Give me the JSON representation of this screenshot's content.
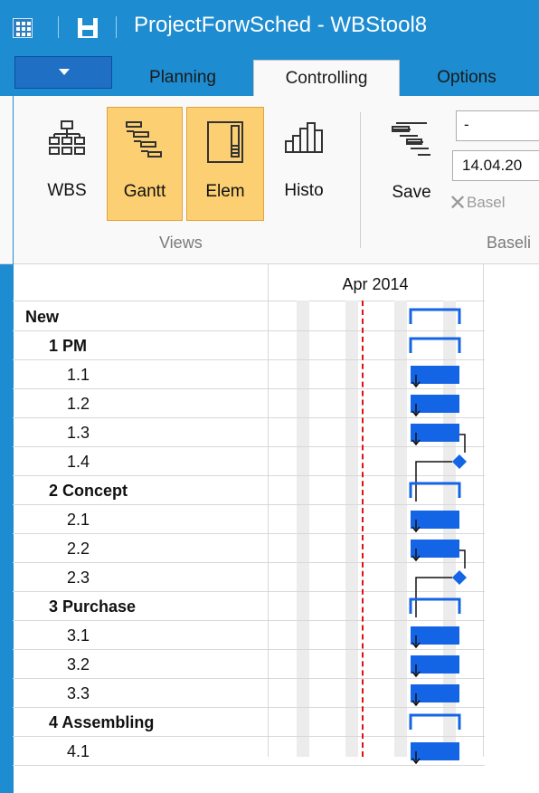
{
  "title_bar": {
    "app_icon": "grid-app-icon",
    "save_icon": "floppy-disk-icon",
    "title": "ProjectForwSched - WBStool8"
  },
  "tabs": [
    {
      "label": "Planning",
      "active": false
    },
    {
      "label": "Controlling",
      "active": true
    },
    {
      "label": "Options",
      "active": false
    }
  ],
  "ribbon": {
    "buttons": [
      {
        "label": "WBS",
        "icon": "wbs-tree-icon",
        "pressed": false
      },
      {
        "label": "Gantt",
        "icon": "gantt-chart-icon",
        "pressed": true
      },
      {
        "label": "Elem",
        "icon": "element-panel-icon",
        "pressed": true
      },
      {
        "label": "Histo",
        "icon": "histogram-icon",
        "pressed": false
      },
      {
        "label": "Save",
        "icon": "save-baseline-icon",
        "pressed": false
      }
    ],
    "views_group_label": "Views",
    "baseline_group_label": "Baseli",
    "baseline_combo_value": "-",
    "baseline_date_value": "14.04.20",
    "baseline_delete_label": "Basel"
  },
  "gantt": {
    "month_header": "Apr 2014",
    "tasks": [
      {
        "label": "New",
        "level": 0,
        "bold": true,
        "kind": "summary"
      },
      {
        "label": "1 PM",
        "level": 1,
        "bold": true,
        "kind": "summary"
      },
      {
        "label": "1.1",
        "level": 2,
        "bold": false,
        "kind": "task"
      },
      {
        "label": "1.2",
        "level": 2,
        "bold": false,
        "kind": "task"
      },
      {
        "label": "1.3",
        "level": 2,
        "bold": false,
        "kind": "task"
      },
      {
        "label": "1.4",
        "level": 2,
        "bold": false,
        "kind": "milestone"
      },
      {
        "label": "2 Concept",
        "level": 1,
        "bold": true,
        "kind": "summary"
      },
      {
        "label": "2.1",
        "level": 2,
        "bold": false,
        "kind": "task"
      },
      {
        "label": "2.2",
        "level": 2,
        "bold": false,
        "kind": "task"
      },
      {
        "label": "2.3",
        "level": 2,
        "bold": false,
        "kind": "milestone"
      },
      {
        "label": "3 Purchase",
        "level": 1,
        "bold": true,
        "kind": "summary"
      },
      {
        "label": "3.1",
        "level": 2,
        "bold": false,
        "kind": "task"
      },
      {
        "label": "3.2",
        "level": 2,
        "bold": false,
        "kind": "task"
      },
      {
        "label": "3.3",
        "level": 2,
        "bold": false,
        "kind": "task"
      },
      {
        "label": "4 Assembling",
        "level": 1,
        "bold": true,
        "kind": "summary"
      },
      {
        "label": "4.1",
        "level": 2,
        "bold": false,
        "kind": "task"
      }
    ],
    "colors": {
      "bar": "#1464e6",
      "today_line": "#e01010",
      "pressed_button": "#fbcf72",
      "title_bar": "#1e8cd0"
    }
  }
}
